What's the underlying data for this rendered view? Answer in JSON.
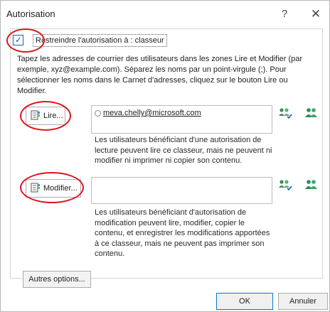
{
  "dialog": {
    "title": "Autorisation",
    "help_glyph": "?",
    "close_glyph": "✕"
  },
  "restrict": {
    "checked": true,
    "label": "Restreindre l'autorisation à : classeur"
  },
  "instructions": "Tapez les adresses de courrier des utilisateurs dans les zones Lire et Modifier (par exemple, xyz@example.com). Séparez les noms par un point-virgule (;). Pour sélectionner les noms dans le Carnet d'adresses, cliquez sur le bouton Lire ou Modifier.",
  "read": {
    "button_label": "Lire...",
    "recipients": [
      "meva.chelly@microsoft.com"
    ],
    "description": "Les utilisateurs bénéficiant d'une autorisation de lecture peuvent lire ce classeur, mais ne peuvent ni modifier ni imprimer ni copier son contenu."
  },
  "modify": {
    "button_label": "Modifier...",
    "recipients": [],
    "description": "Les utilisateurs bénéficiant d'autorisation de modification peuvent lire, modifier, copier le contenu, et enregistrer les modifications apportées à ce classeur, mais ne peuvent pas imprimer son contenu."
  },
  "buttons": {
    "more_options": "Autres options...",
    "ok": "OK",
    "cancel": "Annuler"
  },
  "icons": {
    "check_names": "check-names-icon",
    "address_book": "address-book-icon"
  },
  "colors": {
    "accent": "#0078d7",
    "annotation": "#e0141e",
    "people_icon": "#2e8b57"
  }
}
